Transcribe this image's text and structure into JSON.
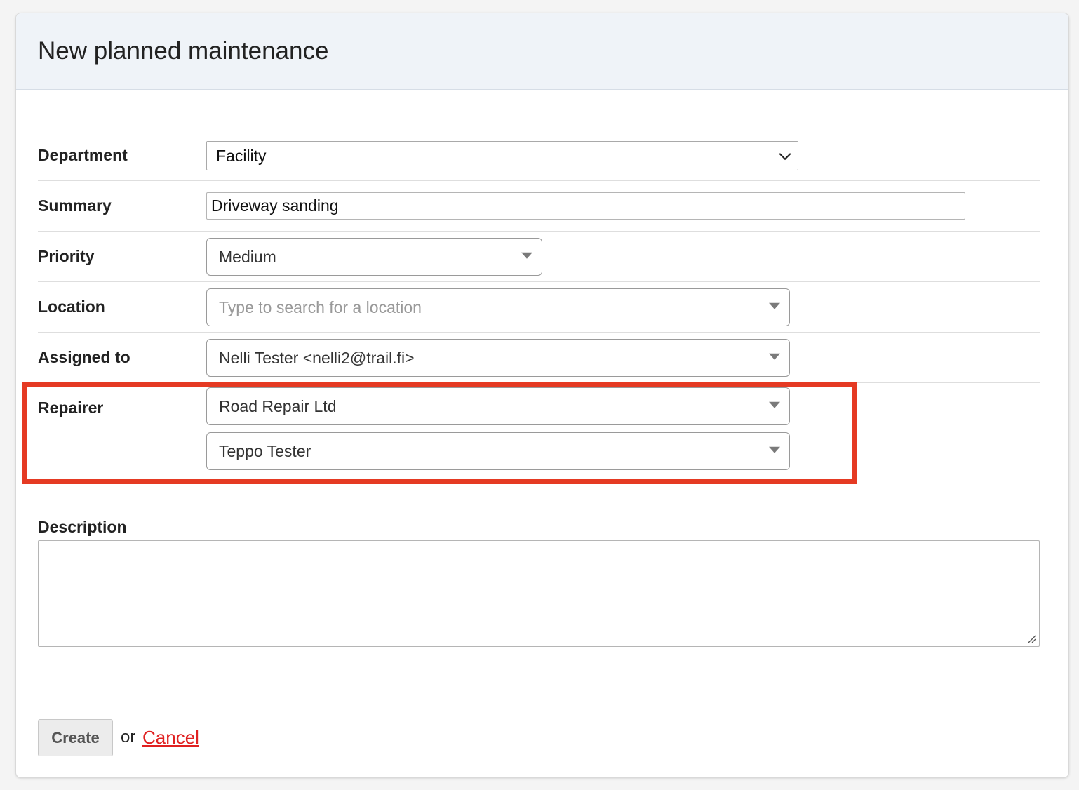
{
  "header": {
    "title": "New planned maintenance"
  },
  "form": {
    "department": {
      "label": "Department",
      "value": "Facility"
    },
    "summary": {
      "label": "Summary",
      "value": "Driveway sanding"
    },
    "priority": {
      "label": "Priority",
      "value": "Medium"
    },
    "location": {
      "label": "Location",
      "placeholder": "Type to search for a location"
    },
    "assigned_to": {
      "label": "Assigned to",
      "value": "Nelli Tester <nelli2@trail.fi>"
    },
    "repairer": {
      "label": "Repairer",
      "company": "Road Repair Ltd",
      "person": "Teppo Tester"
    },
    "description": {
      "label": "Description",
      "value": ""
    }
  },
  "actions": {
    "create_label": "Create",
    "or_text": "or",
    "cancel_label": "Cancel"
  },
  "colors": {
    "header_bg": "#eff3f8",
    "highlight": "#e53a23",
    "cancel_link": "#e02020"
  },
  "icons": [
    "chevron-down-icon",
    "caret-down-icon",
    "resize-grip-icon"
  ]
}
